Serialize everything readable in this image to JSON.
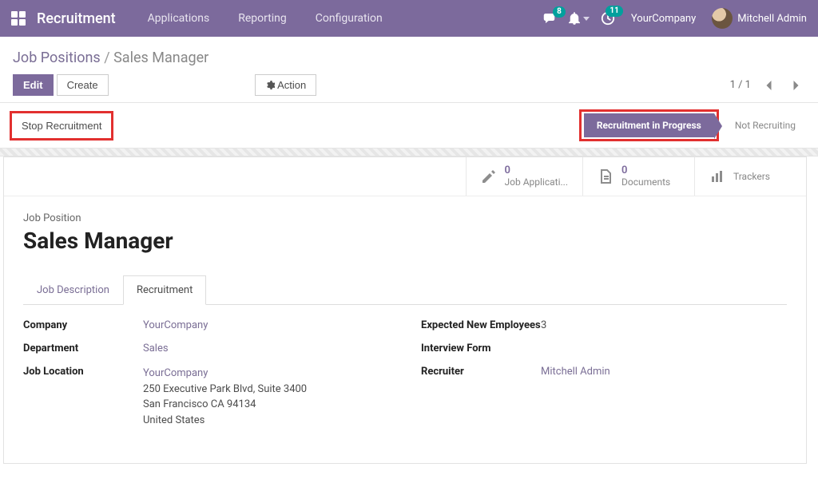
{
  "nav": {
    "app": "Recruitment",
    "links": [
      "Applications",
      "Reporting",
      "Configuration"
    ],
    "msg_count": "8",
    "activity_count": "11",
    "company": "YourCompany",
    "user": "Mitchell Admin"
  },
  "breadcrumb": {
    "parent": "Job Positions",
    "current": "Sales Manager"
  },
  "buttons": {
    "edit": "Edit",
    "create": "Create",
    "action": "Action",
    "stop": "Stop Recruitment"
  },
  "pager": {
    "text": "1 / 1"
  },
  "status": {
    "active": "Recruitment in Progress",
    "inactive": "Not Recruiting"
  },
  "stats": {
    "apps_count": "0",
    "apps_label": "Job Applicati...",
    "docs_count": "0",
    "docs_label": "Documents",
    "trackers_label": "Trackers"
  },
  "record": {
    "section": "Job Position",
    "title": "Sales Manager"
  },
  "tabs": {
    "desc": "Job Description",
    "recruit": "Recruitment"
  },
  "fields": {
    "company_label": "Company",
    "company_value": "YourCompany",
    "dept_label": "Department",
    "dept_value": "Sales",
    "loc_label": "Job Location",
    "loc_line1": "YourCompany",
    "loc_line2": "250 Executive Park Blvd, Suite 3400",
    "loc_line3": "San Francisco CA 94134",
    "loc_line4": "United States",
    "expected_label": "Expected New Employees",
    "expected_value": "3",
    "form_label": "Interview Form",
    "recruiter_label": "Recruiter",
    "recruiter_value": "Mitchell Admin"
  }
}
